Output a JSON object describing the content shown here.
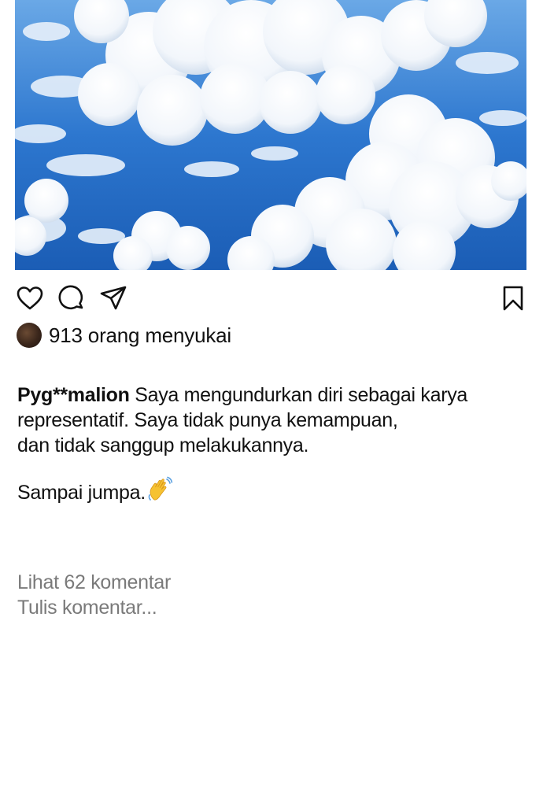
{
  "post": {
    "image_alt": "clouds over sea",
    "icons": {
      "like": "heart-icon",
      "comment": "comment-bubble-icon",
      "share": "paper-plane-icon",
      "save": "bookmark-icon"
    },
    "likes_text": "913 orang menyukai",
    "caption": {
      "username": "Pyg**malion",
      "line1": " Saya mengundurkan diri sebagai karya",
      "line2": "representatif. Saya tidak punya kemampuan,",
      "line3": "dan tidak sanggup melakukannya.",
      "line4": "Sampai jumpa."
    },
    "view_comments": "Lihat 62 komentar",
    "write_comment": "Tulis komentar..."
  },
  "colors": {
    "text": "#111111",
    "muted": "#7a7a7a",
    "sky_blue": "#2f79cf"
  }
}
